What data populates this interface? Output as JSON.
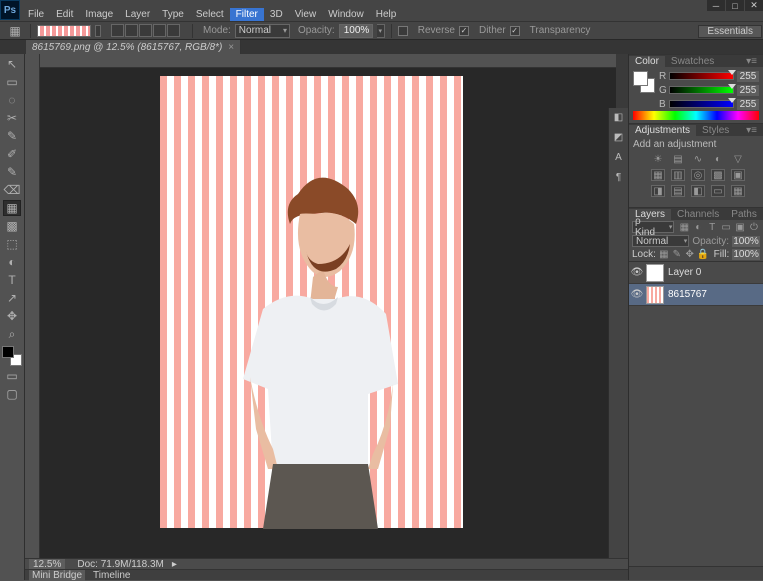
{
  "app": {
    "menus": [
      "File",
      "Edit",
      "Image",
      "Layer",
      "Type",
      "Select",
      "Filter",
      "3D",
      "View",
      "Window",
      "Help"
    ],
    "active_menu_index": 6
  },
  "window_controls": {
    "minimize": "─",
    "maximize": "□",
    "close": "✕"
  },
  "workspace_label": "Essentials",
  "options_bar": {
    "mode_label": "Mode:",
    "mode_value": "Normal",
    "opacity_label": "Opacity:",
    "opacity_value": "100%",
    "reverse_label": "Reverse",
    "dither_label": "Dither",
    "transparency_label": "Transparency",
    "reverse_checked": false,
    "dither_checked": true,
    "transparency_checked": true
  },
  "document": {
    "tab_title": "8615769.png @ 12.5% (8615767, RGB/8*)"
  },
  "status": {
    "zoom": "12.5%",
    "doc_info": "Doc: 71.9M/118.3M",
    "mini_bridge": "Mini Bridge",
    "timeline": "Timeline"
  },
  "panels": {
    "color": {
      "tab_color": "Color",
      "tab_swatches": "Swatches",
      "r_label": "R",
      "g_label": "G",
      "b_label": "B",
      "r": "255",
      "g": "255",
      "b": "255"
    },
    "adjustments": {
      "tab_adjustments": "Adjustments",
      "tab_styles": "Styles",
      "heading": "Add an adjustment"
    },
    "layers": {
      "tab_layers": "Layers",
      "tab_channels": "Channels",
      "tab_paths": "Paths",
      "kind_label": "ρ Kind",
      "blend_mode": "Normal",
      "opacity_label": "Opacity:",
      "opacity_value": "100%",
      "lock_label": "Lock:",
      "fill_label": "Fill:",
      "fill_value": "100%",
      "items": [
        {
          "name": "Layer 0"
        },
        {
          "name": "8615767"
        }
      ]
    }
  },
  "tool_icons": [
    "↖",
    "▭",
    "◌",
    "✂",
    "✎",
    "✐",
    "✎",
    "⌫",
    "▦",
    "▩",
    "⬚",
    "◐",
    "T",
    "↗",
    "✥",
    "⌕",
    "☰"
  ]
}
